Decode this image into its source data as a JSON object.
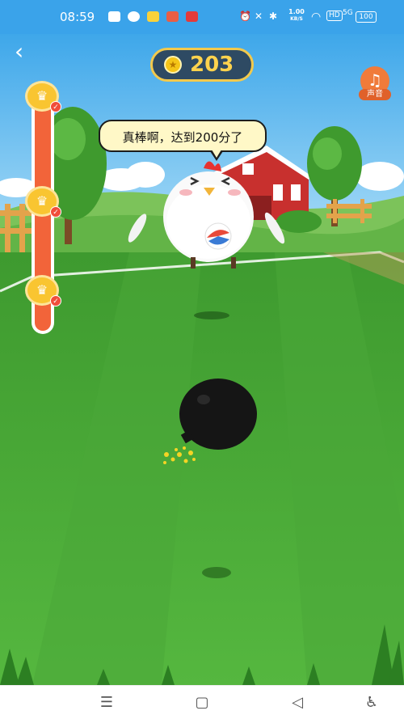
{
  "status_bar": {
    "time": "08:59",
    "network_speed": "1.00",
    "network_speed_unit": "KB/S",
    "hd_label": "HD",
    "signal_label": "5G",
    "battery": "100",
    "app_icons": [
      "wechat-icon",
      "chat-icon",
      "weibo-icon",
      "game-icon",
      "shopping-icon"
    ],
    "status_icons": [
      "alarm-icon",
      "mute-icon",
      "bluetooth-icon",
      "silent-icon",
      "wifi-icon"
    ]
  },
  "header": {
    "back_icon": "back-arrow-icon",
    "score": "203",
    "score_icon": "coin-icon",
    "sound_label": "声音",
    "sound_icon": "music-note-icon"
  },
  "progress": {
    "fraction": 1.0,
    "milestones": [
      {
        "name": "milestone-top",
        "reached": true,
        "icon": "crown-coin-icon"
      },
      {
        "name": "milestone-middle",
        "reached": true,
        "icon": "crown-coin-icon"
      },
      {
        "name": "milestone-bottom",
        "reached": true,
        "icon": "crown-coin-icon"
      }
    ]
  },
  "game": {
    "speech": "真棒啊，达到200分了",
    "character": "chicken",
    "object": "bomb"
  },
  "nav_bar": {
    "icons": [
      "menu-icon",
      "home-icon",
      "back-icon",
      "accessibility-icon"
    ]
  },
  "colors": {
    "sky": "#5bb8f0",
    "grass": "#49a93a",
    "accent": "#f2643a",
    "score_text": "#ffd34d"
  }
}
